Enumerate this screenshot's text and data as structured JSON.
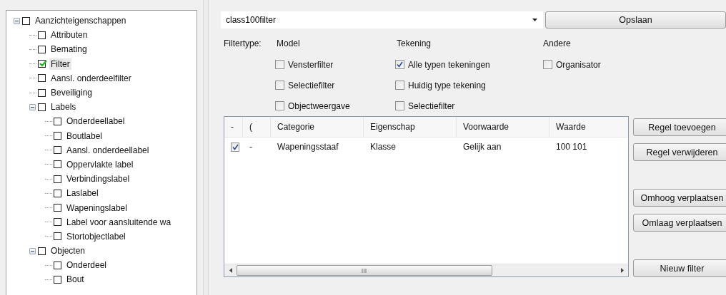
{
  "tree": [
    {
      "label": "Aanzichteigenschappen",
      "checked": false,
      "selected": false,
      "expanded": true,
      "children": [
        {
          "label": "Attributen",
          "checked": false,
          "selected": false
        },
        {
          "label": "Bemating",
          "checked": false,
          "selected": false
        },
        {
          "label": "Filter",
          "checked": true,
          "selected": true
        },
        {
          "label": "Aansl. onderdeelfilter",
          "checked": false,
          "selected": false
        },
        {
          "label": "Beveiliging",
          "checked": false,
          "selected": false
        },
        {
          "label": "Labels",
          "checked": false,
          "selected": false,
          "expanded": true,
          "children": [
            {
              "label": "Onderdeellabel",
              "checked": false,
              "selected": false
            },
            {
              "label": "Boutlabel",
              "checked": false,
              "selected": false
            },
            {
              "label": "Aansl. onderdeellabel",
              "checked": false,
              "selected": false
            },
            {
              "label": "Oppervlakte label",
              "checked": false,
              "selected": false
            },
            {
              "label": "Verbindingslabel",
              "checked": false,
              "selected": false
            },
            {
              "label": "Laslabel",
              "checked": false,
              "selected": false
            },
            {
              "label": "Wapeningslabel",
              "checked": false,
              "selected": false
            },
            {
              "label": "Label voor aansluitende wa",
              "checked": false,
              "selected": false
            },
            {
              "label": "Stortobjectlabel",
              "checked": false,
              "selected": false
            }
          ]
        },
        {
          "label": "Objecten",
          "checked": false,
          "selected": false,
          "expanded": true,
          "children": [
            {
              "label": "Onderdeel",
              "checked": false,
              "selected": false
            },
            {
              "label": "Bout",
              "checked": false,
              "selected": false
            }
          ]
        }
      ]
    }
  ],
  "filter_name": {
    "value": "class100filter"
  },
  "save_button": "Opslaan",
  "filtertype_label": "Filtertype:",
  "groups": [
    {
      "heading": "Model",
      "options": [
        {
          "label": "Vensterfilter",
          "checked": false
        },
        {
          "label": "Selectiefilter",
          "checked": false
        },
        {
          "label": "Objectweergave",
          "checked": false
        }
      ]
    },
    {
      "heading": "Tekening",
      "options": [
        {
          "label": "Alle typen tekeningen",
          "checked": true
        },
        {
          "label": "Huidig type tekening",
          "checked": false
        },
        {
          "label": "Selectiefilter",
          "checked": false
        }
      ]
    },
    {
      "heading": "Andere",
      "options": [
        {
          "label": "Organisator",
          "checked": false
        }
      ]
    }
  ],
  "table": {
    "columns": [
      "-",
      "(",
      "Categorie",
      "Eigenschap",
      "Voorwaarde",
      "Waarde"
    ],
    "rows": [
      {
        "checked": true,
        "cells": [
          "",
          "-",
          "Wapeningsstaaf",
          "Klasse",
          "Gelijk aan",
          "100 101"
        ]
      }
    ]
  },
  "button_groups": [
    [
      "Regel toevoegen",
      "Regel verwijderen"
    ],
    [
      "Omhoog verplaatsen",
      "Omlaag verplaatsen"
    ],
    [
      "Nieuw filter"
    ]
  ]
}
